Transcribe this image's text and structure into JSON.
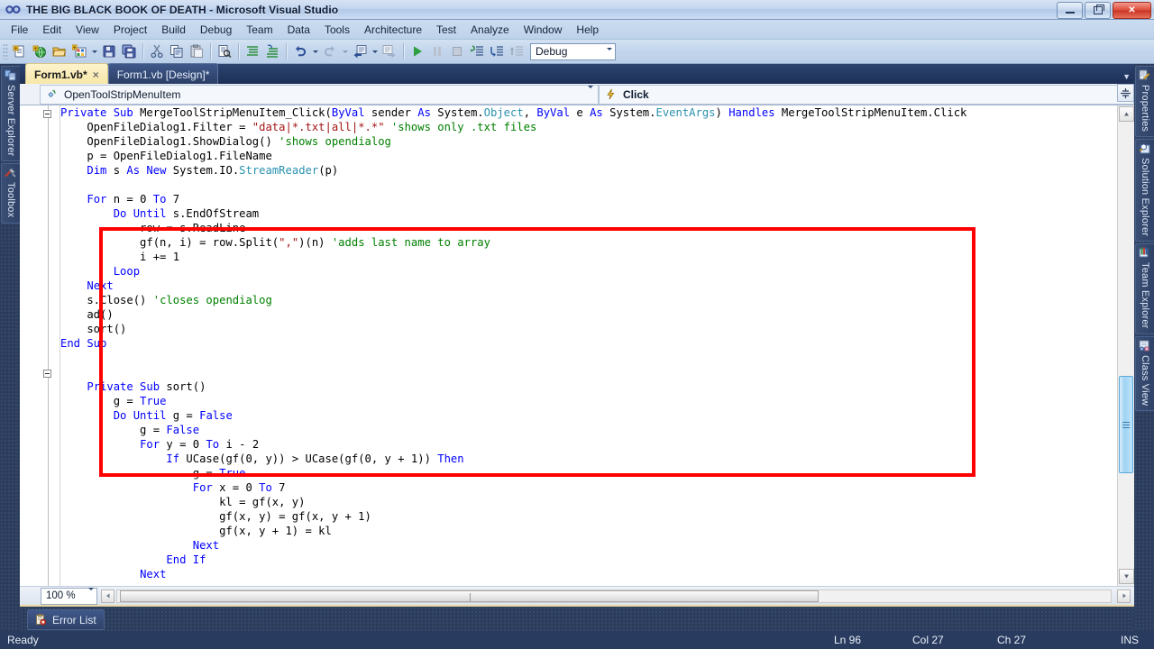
{
  "window": {
    "title": "THE BIG BLACK BOOK OF DEATH - Microsoft Visual Studio",
    "logo_icon": "visual-studio-infinity-icon",
    "minimize_label": "Minimize",
    "maximize_label": "Restore",
    "close_label": "Close"
  },
  "menu": {
    "items": [
      {
        "label": "File"
      },
      {
        "label": "Edit"
      },
      {
        "label": "View"
      },
      {
        "label": "Project"
      },
      {
        "label": "Build"
      },
      {
        "label": "Debug"
      },
      {
        "label": "Team"
      },
      {
        "label": "Data"
      },
      {
        "label": "Tools"
      },
      {
        "label": "Architecture"
      },
      {
        "label": "Test"
      },
      {
        "label": "Analyze"
      },
      {
        "label": "Window"
      },
      {
        "label": "Help"
      }
    ]
  },
  "toolbar": {
    "buttons": [
      {
        "name": "new-project-icon",
        "title": "New Project"
      },
      {
        "name": "add-new-web-site-icon",
        "title": "Add New Web Site"
      },
      {
        "name": "open-file-icon",
        "title": "Open File"
      },
      {
        "name": "add-new-item-icon",
        "title": "Add New Item"
      },
      {
        "name": "save-icon",
        "title": "Save"
      },
      {
        "name": "save-all-icon",
        "title": "Save All"
      },
      {
        "name": "cut-icon",
        "title": "Cut"
      },
      {
        "name": "copy-icon",
        "title": "Copy"
      },
      {
        "name": "paste-icon",
        "title": "Paste"
      },
      {
        "name": "find-icon",
        "title": "Find in Files"
      },
      {
        "name": "comment-icon",
        "title": "Comment out the selected lines"
      },
      {
        "name": "uncomment-icon",
        "title": "Uncomment the selected lines"
      },
      {
        "name": "undo-icon",
        "title": "Undo"
      },
      {
        "name": "redo-icon",
        "title": "Redo"
      },
      {
        "name": "navigate-backward-icon",
        "title": "Navigate Backward"
      },
      {
        "name": "navigate-forward-icon",
        "title": "Navigate Forward"
      },
      {
        "name": "start-debugging-icon",
        "title": "Start Debugging"
      },
      {
        "name": "pause-icon",
        "title": "Break All"
      },
      {
        "name": "stop-icon",
        "title": "Stop Debugging"
      },
      {
        "name": "step-into-icon",
        "title": "Step Into"
      },
      {
        "name": "step-over-icon",
        "title": "Step Over"
      },
      {
        "name": "step-out-icon",
        "title": "Step Out"
      }
    ],
    "configuration": "Debug"
  },
  "dock_left": {
    "tabs": [
      {
        "label": "Server Explorer",
        "icon": "server-explorer-icon"
      },
      {
        "label": "Toolbox",
        "icon": "toolbox-icon"
      }
    ]
  },
  "dock_right": {
    "tabs": [
      {
        "label": "Properties",
        "icon": "properties-icon"
      },
      {
        "label": "Solution Explorer",
        "icon": "solution-explorer-icon"
      },
      {
        "label": "Team Explorer",
        "icon": "team-explorer-icon"
      },
      {
        "label": "Class View",
        "icon": "class-view-icon"
      }
    ]
  },
  "document": {
    "tabs": [
      {
        "label": "Form1.vb*",
        "active": true,
        "close": "×"
      },
      {
        "label": "Form1.vb [Design]*",
        "active": false,
        "close": ""
      }
    ],
    "navbar": {
      "member_left": "OpenToolStripMenuItem",
      "member_left_icon": "method-icon",
      "member_right": "Click",
      "member_right_icon": "event-lightning-icon",
      "dropdown_icon": "chevron-down-icon"
    }
  },
  "editor": {
    "zoom": "100 %",
    "highlight_color": "#ff0000",
    "lines": [
      [
        {
          "t": "Private ",
          "c": "kw"
        },
        {
          "t": "Sub ",
          "c": "kw"
        },
        {
          "t": "MergeToolStripMenuItem_Click(",
          "c": "pl"
        },
        {
          "t": "ByVal ",
          "c": "kw"
        },
        {
          "t": "sender ",
          "c": "pl"
        },
        {
          "t": "As ",
          "c": "kw"
        },
        {
          "t": "System.",
          "c": "pl"
        },
        {
          "t": "Object",
          "c": "typ"
        },
        {
          "t": ", ",
          "c": "pl"
        },
        {
          "t": "ByVal ",
          "c": "kw"
        },
        {
          "t": "e ",
          "c": "pl"
        },
        {
          "t": "As ",
          "c": "kw"
        },
        {
          "t": "System.",
          "c": "pl"
        },
        {
          "t": "EventArgs",
          "c": "typ"
        },
        {
          "t": ") ",
          "c": "pl"
        },
        {
          "t": "Handles ",
          "c": "kw"
        },
        {
          "t": "MergeToolStripMenuItem.Click",
          "c": "pl"
        }
      ],
      [
        {
          "t": "    OpenFileDialog1.Filter = ",
          "c": "pl"
        },
        {
          "t": "\"data|*.txt|all|*.*\" ",
          "c": "str"
        },
        {
          "t": "'shows only .txt files",
          "c": "cmt"
        }
      ],
      [
        {
          "t": "    OpenFileDialog1.ShowDialog() ",
          "c": "pl"
        },
        {
          "t": "'shows opendialog",
          "c": "cmt"
        }
      ],
      [
        {
          "t": "    p = OpenFileDialog1.FileName",
          "c": "pl"
        }
      ],
      [
        {
          "t": "    ",
          "c": "pl"
        },
        {
          "t": "Dim ",
          "c": "kw"
        },
        {
          "t": "s ",
          "c": "pl"
        },
        {
          "t": "As ",
          "c": "kw"
        },
        {
          "t": "New ",
          "c": "kw"
        },
        {
          "t": "System.IO.",
          "c": "pl"
        },
        {
          "t": "StreamReader",
          "c": "typ"
        },
        {
          "t": "(p)",
          "c": "pl"
        }
      ],
      [
        {
          "t": "",
          "c": "pl"
        }
      ],
      [
        {
          "t": "    ",
          "c": "pl"
        },
        {
          "t": "For ",
          "c": "kw"
        },
        {
          "t": "n = 0 ",
          "c": "pl"
        },
        {
          "t": "To ",
          "c": "kw"
        },
        {
          "t": "7",
          "c": "pl"
        }
      ],
      [
        {
          "t": "        ",
          "c": "pl"
        },
        {
          "t": "Do Until ",
          "c": "kw"
        },
        {
          "t": "s.EndOfStream",
          "c": "pl"
        }
      ],
      [
        {
          "t": "            row = s.ReadLine",
          "c": "pl"
        }
      ],
      [
        {
          "t": "            gf(n, i) = row.Split(",
          "c": "pl"
        },
        {
          "t": "\",\"",
          "c": "str"
        },
        {
          "t": ")(n) ",
          "c": "pl"
        },
        {
          "t": "'adds last name to array",
          "c": "cmt"
        }
      ],
      [
        {
          "t": "            i += 1",
          "c": "pl"
        }
      ],
      [
        {
          "t": "        ",
          "c": "pl"
        },
        {
          "t": "Loop",
          "c": "kw"
        }
      ],
      [
        {
          "t": "    ",
          "c": "pl"
        },
        {
          "t": "Next",
          "c": "kw"
        }
      ],
      [
        {
          "t": "    s.Close() ",
          "c": "pl"
        },
        {
          "t": "'closes opendialog",
          "c": "cmt"
        }
      ],
      [
        {
          "t": "    ad()",
          "c": "pl"
        }
      ],
      [
        {
          "t": "    sort()",
          "c": "pl"
        }
      ],
      [
        {
          "t": "End Sub",
          "c": "kw"
        }
      ],
      [
        {
          "t": "",
          "c": "pl"
        }
      ],
      [
        {
          "t": "",
          "c": "pl"
        }
      ],
      [
        {
          "t": "    ",
          "c": "pl"
        },
        {
          "t": "Private Sub ",
          "c": "kw"
        },
        {
          "t": "sort()",
          "c": "pl"
        }
      ],
      [
        {
          "t": "        g = ",
          "c": "pl"
        },
        {
          "t": "True",
          "c": "kw"
        }
      ],
      [
        {
          "t": "        ",
          "c": "pl"
        },
        {
          "t": "Do Until ",
          "c": "kw"
        },
        {
          "t": "g = ",
          "c": "pl"
        },
        {
          "t": "False",
          "c": "kw"
        }
      ],
      [
        {
          "t": "            g = ",
          "c": "pl"
        },
        {
          "t": "False",
          "c": "kw"
        }
      ],
      [
        {
          "t": "            ",
          "c": "pl"
        },
        {
          "t": "For ",
          "c": "kw"
        },
        {
          "t": "y = 0 ",
          "c": "pl"
        },
        {
          "t": "To ",
          "c": "kw"
        },
        {
          "t": "i - 2",
          "c": "pl"
        }
      ],
      [
        {
          "t": "                ",
          "c": "pl"
        },
        {
          "t": "If ",
          "c": "kw"
        },
        {
          "t": "UCase(gf(0, y)) > UCase(gf(0, y + 1)) ",
          "c": "pl"
        },
        {
          "t": "Then",
          "c": "kw"
        }
      ],
      [
        {
          "t": "                    g = ",
          "c": "pl"
        },
        {
          "t": "True",
          "c": "kw"
        }
      ],
      [
        {
          "t": "                    ",
          "c": "pl"
        },
        {
          "t": "For ",
          "c": "kw"
        },
        {
          "t": "x = 0 ",
          "c": "pl"
        },
        {
          "t": "To ",
          "c": "kw"
        },
        {
          "t": "7",
          "c": "pl"
        }
      ],
      [
        {
          "t": "                        kl = gf(x, y)",
          "c": "pl"
        }
      ],
      [
        {
          "t": "                        gf(x, y) = gf(x, y + 1)",
          "c": "pl"
        }
      ],
      [
        {
          "t": "                        gf(x, y + 1) = kl",
          "c": "pl"
        }
      ],
      [
        {
          "t": "                    ",
          "c": "pl"
        },
        {
          "t": "Next",
          "c": "kw"
        }
      ],
      [
        {
          "t": "                ",
          "c": "pl"
        },
        {
          "t": "End If",
          "c": "kw"
        }
      ],
      [
        {
          "t": "            ",
          "c": "pl"
        },
        {
          "t": "Next",
          "c": "kw"
        }
      ]
    ]
  },
  "bottom_dock": {
    "tabs": [
      {
        "label": "Error List",
        "icon": "error-list-icon"
      }
    ]
  },
  "statusbar": {
    "status": "Ready",
    "line": "Ln 96",
    "column": "Col 27",
    "character": "Ch 27",
    "insert_mode": "INS"
  }
}
